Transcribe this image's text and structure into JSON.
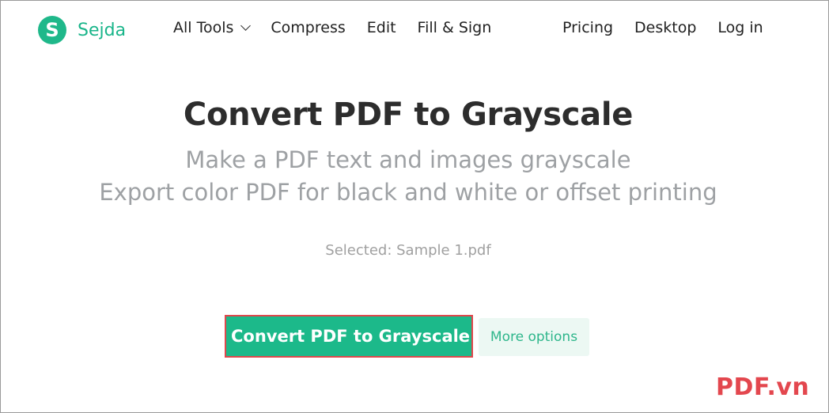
{
  "header": {
    "logo_letter": "S",
    "logo_text": "Sejda",
    "nav_left": [
      {
        "label": "All Tools",
        "has_dropdown": true
      },
      {
        "label": "Compress"
      },
      {
        "label": "Edit"
      },
      {
        "label": "Fill & Sign"
      }
    ],
    "nav_right": [
      {
        "label": "Pricing"
      },
      {
        "label": "Desktop"
      },
      {
        "label": "Log in"
      }
    ]
  },
  "main": {
    "title": "Convert PDF to Grayscale",
    "subtitle_line1": "Make a PDF text and images grayscale",
    "subtitle_line2": "Export color PDF for black and white or offset printing",
    "selected_file": "Selected: Sample 1.pdf",
    "primary_button": "Convert PDF to Grayscale",
    "secondary_button": "More options"
  },
  "watermark": "PDF.vn",
  "colors": {
    "brand": "#1cb98a",
    "highlight_border": "#e0474c",
    "watermark": "#e3474e"
  }
}
